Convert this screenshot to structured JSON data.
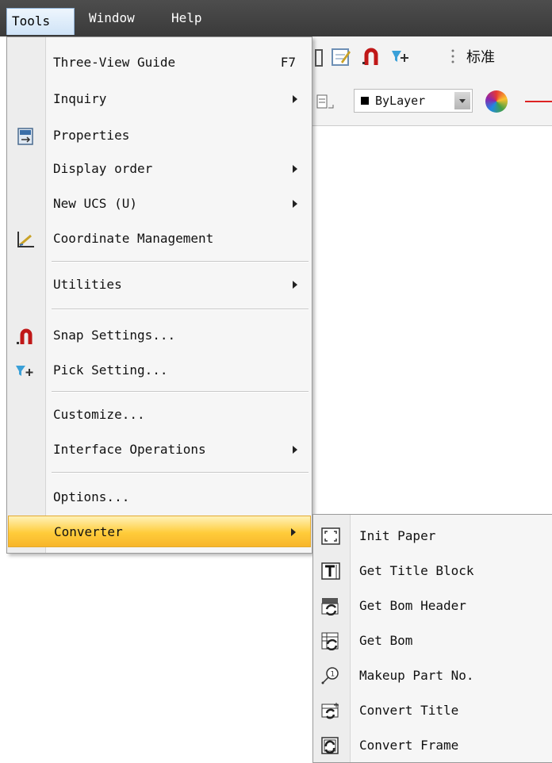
{
  "menubar": {
    "tools": "Tools",
    "window": "Window",
    "help": "Help"
  },
  "toolbar": {
    "style_name": "标准",
    "layer": "ByLayer"
  },
  "tools_menu": {
    "three_view_guide": "Three-View Guide",
    "three_view_shortcut": "F7",
    "inquiry": "Inquiry",
    "properties": "Properties",
    "display_order": "Display order",
    "new_ucs": "New UCS (U)",
    "coordinate_management": "Coordinate Management",
    "utilities": "Utilities",
    "snap_settings": "Snap Settings...",
    "pick_setting": "Pick Setting...",
    "customize": "Customize...",
    "interface_operations": "Interface Operations",
    "options": "Options...",
    "converter": "Converter"
  },
  "converter_menu": {
    "init_paper": "Init Paper",
    "get_title_block": "Get Title Block",
    "get_bom_header": "Get Bom Header",
    "get_bom": "Get Bom",
    "makeup_part_no": "Makeup Part No.",
    "convert_title": "Convert Title",
    "convert_frame": "Convert Frame"
  },
  "icons": {
    "properties": "properties-icon",
    "coordinate_management": "coordinate-icon",
    "snap_settings": "magnet-icon",
    "pick_setting": "pick-filter-icon",
    "init_paper": "frame-corners-icon",
    "get_title_block": "title-block-icon",
    "get_bom_header": "bom-header-icon",
    "get_bom": "bom-icon",
    "makeup_part_no": "balloon-icon",
    "convert_title": "convert-title-icon",
    "convert_frame": "convert-frame-icon"
  },
  "colors": {
    "highlight": "#ffcc3a",
    "menubar": "#3f3f3f",
    "menu_bg": "#f6f6f6"
  }
}
